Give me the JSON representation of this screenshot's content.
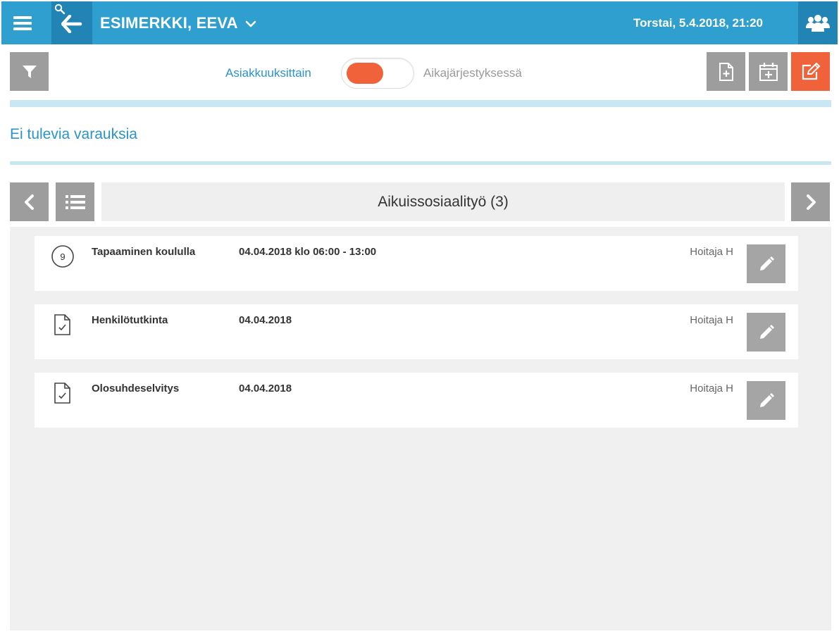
{
  "header": {
    "patient_name": "ESIMERKKI, EEVA",
    "datetime": "Torstai, 5.4.2018, 21:20",
    "icons": {
      "menu": "hamburger-menu-icon",
      "search": "search-icon",
      "back": "arrow-left-icon",
      "dropdown": "chevron-down-icon",
      "users": "users-group-icon"
    }
  },
  "toolbar": {
    "toggle_left_label": "Asiakkuuksittain",
    "toggle_right_label": "Aikajärjestyksessä",
    "toggle_state": "left",
    "icons": [
      "filter-icon",
      "new-document-icon",
      "add-calendar-icon",
      "edit-note-icon"
    ]
  },
  "bookings": {
    "empty_message": "Ei tulevia varauksia"
  },
  "category": {
    "title": "Aikuissosiaalityö (3)",
    "icons": [
      "chevron-left-icon",
      "list-icon",
      "chevron-right-icon"
    ]
  },
  "items": [
    {
      "icon": "clock-9-icon",
      "icon_text": "9",
      "title": "Tapaaminen koululla",
      "date": "04.04.2018 klo 06:00 - 13:00",
      "person": "Hoitaja H"
    },
    {
      "icon": "document-check-icon",
      "title": "Henkilötutkinta",
      "date": "04.04.2018",
      "person": "Hoitaja H"
    },
    {
      "icon": "document-check-icon",
      "title": "Olosuhdeselvitys",
      "date": "04.04.2018",
      "person": "Hoitaja H"
    }
  ],
  "colors": {
    "header_blue": "#2f9fcf",
    "header_dark_blue": "#2184b4",
    "accent_orange": "#f0623a",
    "link_blue": "#2b93c8",
    "button_gray": "#9d9d9d",
    "list_bg": "#f0f0f0"
  }
}
